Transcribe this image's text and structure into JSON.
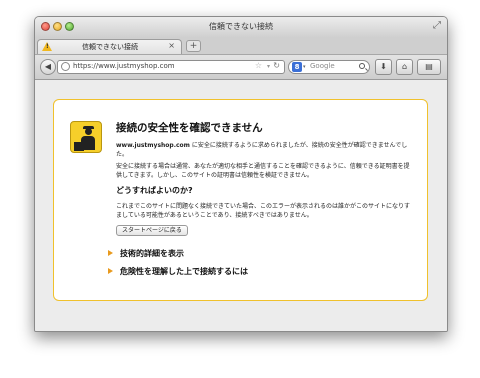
{
  "window": {
    "title": "信頼できない接続"
  },
  "tab": {
    "label": "信頼できない接続",
    "close": "×",
    "new_tab": "+"
  },
  "toolbar": {
    "url": "https://www.justmyshop.com",
    "search_engine_badge": "8",
    "search_placeholder": "Google"
  },
  "icons": {
    "back": "◀",
    "star": "☆",
    "reload": "↻",
    "dropdown": "▾",
    "download": "⬇",
    "home": "⌂",
    "bookmarks": "▤",
    "fullscreen": "⤢",
    "warning": "!"
  },
  "error": {
    "title": "接続の安全性を確認できません",
    "host": "www.justmyshop.com",
    "intro_rest": " に安全に接続するように求められましたが、接続の安全性が確認できませんでした。",
    "explanation": "安全に接続する場合は通常、あなたが適切な相手と通信することを確認できるように、信頼できる証明書を提供してきます。しかし、このサイトの証明書は信頼性を検証できません。",
    "what_heading": "どうすればよいのか?",
    "what_text": "これまでこのサイトに問題なく接続できていた場合、このエラーが表示されるのは誰かがこのサイトになりすましている可能性があるということであり、接続すべきではありません。",
    "get_me_out": "スタートページに戻る",
    "technical_details": "技術的詳細を表示",
    "understand_risks": "危険性を理解した上で接続するには"
  },
  "colors": {
    "card_border": "#f0c12c",
    "badge": "#f6cf2a",
    "expander_arrow": "#e89a1e"
  }
}
